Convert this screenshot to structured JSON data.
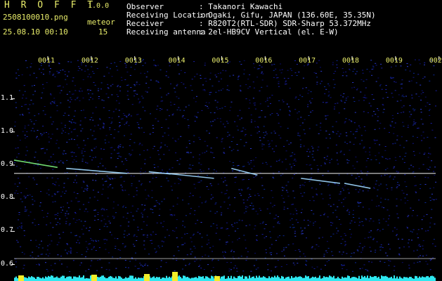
{
  "header": {
    "app_name": "H R O F F T",
    "version": "1.0.0",
    "filename": "2508100010.png",
    "meteor_label": "meteor",
    "timestamp": "25.08.10 00:10",
    "meteor_count": "15",
    "info": [
      {
        "label": "Observer",
        "value": ": Takanori Kawachi"
      },
      {
        "label": "Receiving Location",
        "value": ": Ogaki, Gifu, JAPAN (136.60E, 35.35N)"
      },
      {
        "label": "Receiver",
        "value": ": R820T2(RTL-SDR) SDR-Sharp 53.372MHz"
      },
      {
        "label": "Receiving antenna",
        "value": ": 2el-HB9CV Vertical (el. E-W)"
      }
    ]
  },
  "axis": {
    "unit": "kHz",
    "x_ticks": [
      "0011",
      "0012",
      "0013",
      "0014",
      "0015",
      "0016",
      "0017",
      "0018",
      "0019",
      "0020"
    ],
    "y_ticks": [
      "1.1",
      "1.0",
      "0.9",
      "0.8",
      "0.7",
      "0.6"
    ]
  },
  "colors": {
    "background": "#000000",
    "noise_dark": "#0a0d6a",
    "signal": "#ffffff",
    "trail": "#7cf07c",
    "activity_bar": "#2ee8f0",
    "activity_peak": "#f2ee2a",
    "label_yellow": "#e8ec6a"
  },
  "chart_data": {
    "type": "heatmap",
    "x_unit": "minute",
    "x_ticks": [
      "0011",
      "0012",
      "0013",
      "0014",
      "0015",
      "0016",
      "0017",
      "0018",
      "0019",
      "0020"
    ],
    "y_unit": "kHz",
    "ylim": [
      0.58,
      1.22
    ],
    "carrier_khz": 0.875,
    "reference_line_khz": 0.618,
    "meteor_count": 15,
    "meteors": [
      {
        "x_start": 0.0,
        "x_end": 1.0,
        "khz_start": 0.915,
        "khz_end": 0.893
      },
      {
        "x_start": 1.2,
        "x_end": 2.6,
        "khz_start": 0.89,
        "khz_end": 0.875
      },
      {
        "x_start": 3.1,
        "x_end": 3.6,
        "khz_start": 0.88,
        "khz_end": 0.873
      },
      {
        "x_start": 3.5,
        "x_end": 4.6,
        "khz_start": 0.875,
        "khz_end": 0.86
      },
      {
        "x_start": 5.0,
        "x_end": 5.6,
        "khz_start": 0.89,
        "khz_end": 0.87
      },
      {
        "x_start": 6.6,
        "x_end": 7.5,
        "khz_start": 0.86,
        "khz_end": 0.845
      },
      {
        "x_start": 7.6,
        "x_end": 8.2,
        "khz_start": 0.845,
        "khz_end": 0.83
      }
    ]
  }
}
